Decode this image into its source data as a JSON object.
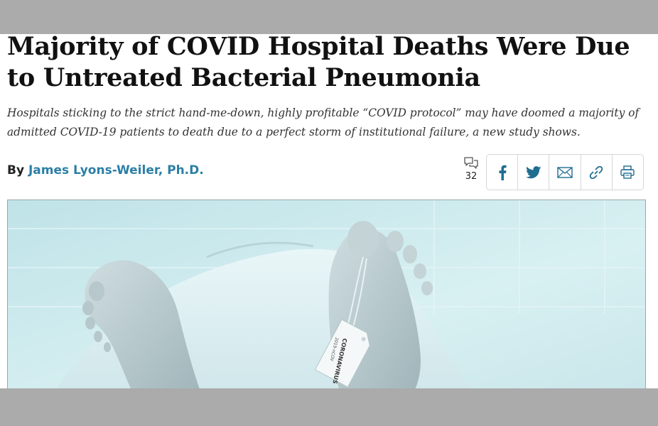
{
  "article": {
    "title": "Majority of COVID Hospital Deaths Were Due to Untreated Bacterial Pneumonia",
    "subtitle": "Hospitals sticking to the strict hand-me-down, highly profitable “COVID protocol” may have doomed a majority of admitted COVID-19 patients to death due to a perfect storm of institutional failure, a new study shows.",
    "byline_prefix": "By",
    "author": "James Lyons-Weiler, Ph.D.",
    "comment_count": "32"
  },
  "share_buttons": [
    {
      "icon": "facebook-icon"
    },
    {
      "icon": "twitter-icon"
    },
    {
      "icon": "email-icon"
    },
    {
      "icon": "link-icon"
    },
    {
      "icon": "print-icon"
    }
  ],
  "hero_image": {
    "toe_tag_line1": "CORONAVIRUS",
    "toe_tag_line2": "2019-nCOV"
  },
  "colors": {
    "author_link": "#2b7fa6",
    "share_icons": "#1f6d8f",
    "chrome_gray": "#ababab"
  }
}
